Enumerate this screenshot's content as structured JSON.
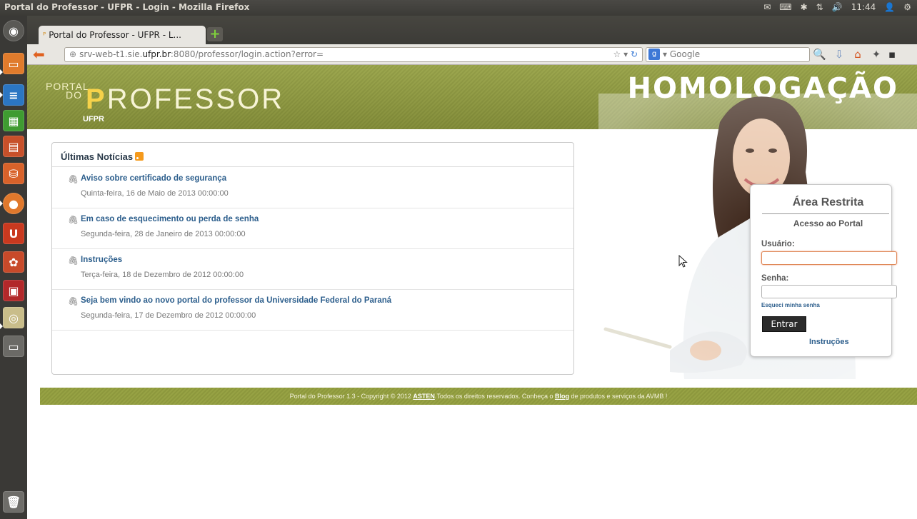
{
  "os": {
    "window_title": "Portal do Professor - UFPR - Login - Mozilla Firefox",
    "clock": "11:44"
  },
  "browser": {
    "tab_title": "Portal do Professor - UFPR - L...",
    "url_prefix": "srv-web-t1.sie.",
    "url_host": "ufpr.br",
    "url_suffix": ":8080/professor/login.action?error=",
    "search_placeholder": "Google"
  },
  "header": {
    "logo_small": "PORTAL",
    "logo_do": "DO",
    "logo_p": "P",
    "logo_rest": "ROFESSOR",
    "logo_sub": "UFPR",
    "env_label": "HOMOLOGAÇÃO"
  },
  "news": {
    "title": "Últimas Notícias",
    "items": [
      {
        "headline": "Aviso sobre certificado de segurança",
        "date": "Quinta-feira, 16 de Maio de 2013 00:00:00"
      },
      {
        "headline": "Em caso de esquecimento ou perda de senha",
        "date": "Segunda-feira, 28 de Janeiro de 2013 00:00:00"
      },
      {
        "headline": "Instruções",
        "date": "Terça-feira, 18 de Dezembro de 2012 00:00:00"
      },
      {
        "headline": "Seja bem vindo ao novo portal do professor da Universidade Federal do Paraná",
        "date": "Segunda-feira, 17 de Dezembro de 2012 00:00:00"
      }
    ]
  },
  "login": {
    "title": "Área Restrita",
    "subtitle": "Acesso ao Portal",
    "user_label": "Usuário:",
    "user_value": "",
    "password_label": "Senha:",
    "password_value": "",
    "forgot_link": "Esqueci minha senha",
    "submit_label": "Entrar",
    "instructions_link": "Instruções"
  },
  "footer": {
    "text_before": "Portal do Professor 1.3 - Copyright © 2012 ",
    "asten": "ASTEN",
    "text_middle": ".Todos os direitos reservados. Conheça o ",
    "blog": "Blog",
    "text_after": " de produtos e serviços da AVMB !"
  },
  "colors": {
    "header_olive": "#93a03f",
    "link_blue": "#2c5e8c"
  }
}
